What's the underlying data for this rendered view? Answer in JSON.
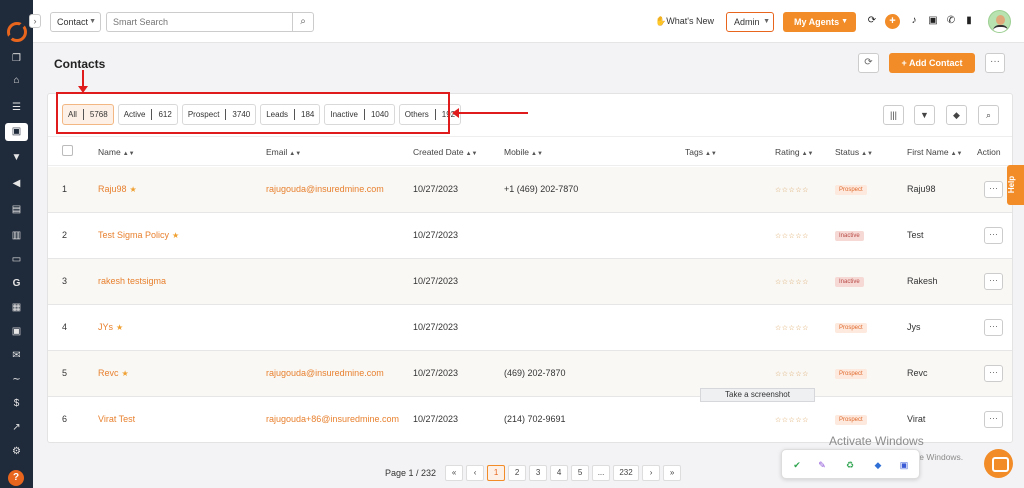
{
  "topbar": {
    "search_type": "Contact",
    "search_placeholder": "Smart Search",
    "whats_new": "What's New",
    "admin_label": "Admin",
    "my_agents_label": "My Agents"
  },
  "page": {
    "title": "Contacts",
    "add_contact_label": "+ Add Contact"
  },
  "filters": [
    {
      "label": "All",
      "count": "5768"
    },
    {
      "label": "Active",
      "count": "612"
    },
    {
      "label": "Prospect",
      "count": "3740"
    },
    {
      "label": "Leads",
      "count": "184"
    },
    {
      "label": "Inactive",
      "count": "1040"
    },
    {
      "label": "Others",
      "count": "192"
    }
  ],
  "table": {
    "headers": {
      "name": "Name",
      "email": "Email",
      "created": "Created Date",
      "mobile": "Mobile",
      "tags": "Tags",
      "rating": "Rating",
      "status": "Status",
      "first_name": "First Name",
      "action": "Action"
    },
    "rating_stars": "☆☆☆☆☆",
    "rows": [
      {
        "num": "1",
        "name": "Raju98",
        "starred": true,
        "email": "rajugouda@insuredmine.com",
        "created": "10/27/2023",
        "mobile": "+1 (469) 202-7870",
        "status": "Prospect",
        "status_kind": "prospect",
        "first_name": "Raju98"
      },
      {
        "num": "2",
        "name": "Test Sigma Policy",
        "starred": true,
        "email": "",
        "created": "10/27/2023",
        "mobile": "",
        "status": "Inactive",
        "status_kind": "inactive",
        "first_name": "Test"
      },
      {
        "num": "3",
        "name": "rakesh testsigma",
        "starred": false,
        "email": "",
        "created": "10/27/2023",
        "mobile": "",
        "status": "Inactive",
        "status_kind": "inactive",
        "first_name": "Rakesh"
      },
      {
        "num": "4",
        "name": "JYs",
        "starred": true,
        "email": "",
        "created": "10/27/2023",
        "mobile": "",
        "status": "Prospect",
        "status_kind": "prospect",
        "first_name": "Jys"
      },
      {
        "num": "5",
        "name": "Revc",
        "starred": true,
        "email": "rajugouda@insuredmine.com",
        "created": "10/27/2023",
        "mobile": "(469) 202-7870",
        "status": "Prospect",
        "status_kind": "prospect",
        "first_name": "Revc"
      },
      {
        "num": "6",
        "name": "Virat Test",
        "starred": false,
        "email": "rajugouda+86@insuredmine.com",
        "created": "10/27/2023",
        "mobile": "(214) 702-9691",
        "status": "Prospect",
        "status_kind": "prospect",
        "first_name": "Virat"
      }
    ]
  },
  "pagination": {
    "label": "Page 1 / 232",
    "pages": [
      "«",
      "‹",
      "1",
      "2",
      "3",
      "4",
      "5",
      "...",
      "232",
      "›",
      "»"
    ],
    "current": "1"
  },
  "help_label": "Help",
  "tooltip": "Take a screenshot",
  "watermark": {
    "title": "Activate Windows",
    "subtitle": "Go to Settings to activate Windows."
  },
  "colors": {
    "accent": "#f28c28",
    "sidebar": "#1f2a3a",
    "annotation": "#e01b1b"
  }
}
